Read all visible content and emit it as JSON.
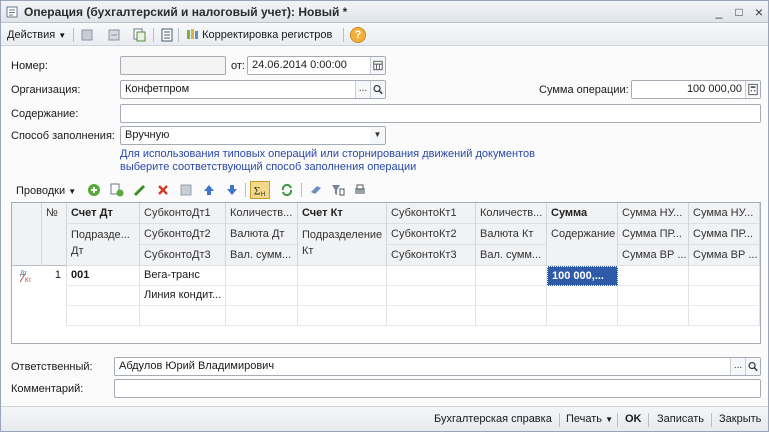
{
  "window": {
    "title": "Операция (бухгалтерский и налоговый учет): Новый *",
    "minimize": "_",
    "maximize": "□",
    "close": "×"
  },
  "toolbar": {
    "actions_label": "Действия",
    "registers_label": "Корректировка регистров",
    "help_icon": "?"
  },
  "form": {
    "number_label": "Номер:",
    "number_value": "",
    "date_label": "от:",
    "date_value": "24.06.2014  0:00:00",
    "org_label": "Организация:",
    "org_value": "Конфетпром",
    "amount_label": "Сумма операции:",
    "amount_value": "100 000,00",
    "content_label": "Содержание:",
    "content_value": "",
    "fill_label": "Способ заполнения:",
    "fill_value": "Вручную",
    "hint_line1": "Для использования типовых операций или сторнирования движений документов",
    "hint_line2": "выберите соответствующий способ заполнения операции"
  },
  "grid_toolbar": {
    "postings_label": "Проводки"
  },
  "table": {
    "headers_row1": [
      "№",
      "Счет Дт",
      "СубконтоДт1",
      "Количеств...",
      "Счет Кт",
      "СубконтоКт1",
      "Количеств...",
      "Сумма",
      "Сумма НУ...",
      "Сумма НУ..."
    ],
    "headers_row2": [
      "Подразде...",
      "СубконтоДт2",
      "Валюта Дт",
      "Подразделение",
      "СубконтоКт2",
      "Валюта Кт",
      "Содержание",
      "Сумма ПР...",
      "Сумма ПР..."
    ],
    "headers_row2b": [
      "Дт",
      "Кт"
    ],
    "headers_row3": [
      "СубконтоДт3",
      "Вал. сумм...",
      "СубконтоКт3",
      "Вал. сумм...",
      "Сумма ВР ...",
      "Сумма ВР ..."
    ],
    "rows": [
      {
        "num": "1",
        "account_dt": "001",
        "subconto_dt1": "Вега-транс",
        "subconto_dt2": "Линия кондит...",
        "amount": "100 000,..."
      }
    ]
  },
  "footer_fields": {
    "responsible_label": "Ответственный:",
    "responsible_value": "Абдулов Юрий Владимирович",
    "comment_label": "Комментарий:",
    "comment_value": ""
  },
  "bottom": {
    "report": "Бухгалтерская справка",
    "print": "Печать",
    "ok": "OK",
    "save": "Записать",
    "close": "Закрыть"
  }
}
